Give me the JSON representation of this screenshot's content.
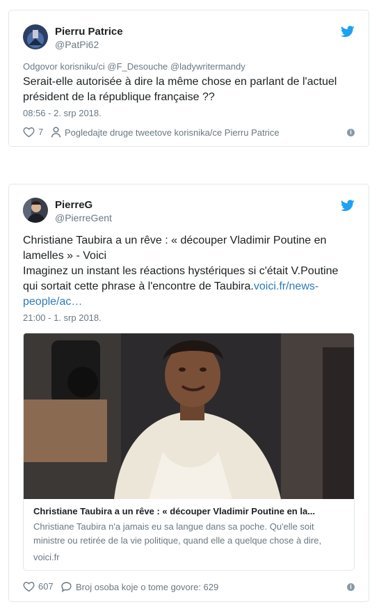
{
  "tweets": [
    {
      "name": "Pierru Patrice",
      "handle": "@PatPi62",
      "reply_to": "Odgovor korisniku/ci @F_Desouche @ladywritermandy",
      "text": "Serait-elle autorisée à dire la même chose en parlant de l'actuel président de la république française ??",
      "time": "08:56 - 2. srp 2018.",
      "likes": "7",
      "action": "Pogledajte druge tweetove korisnika/ce Pierru Patrice"
    },
    {
      "name": "PierreG",
      "handle": "@PierreGent",
      "text_line1": "Christiane Taubira a un rêve : « découper Vladimir Poutine en lamelles » - Voici",
      "text_line2": "Imaginez un instant les réactions hystériques si c'était V.Poutine qui sortait cette phrase à l'encontre de Taubira.",
      "link": "voici.fr/news-people/ac…",
      "time": "21:00 - 1. srp 2018.",
      "card": {
        "title": "Christiane Taubira a un rêve : « découper Vladimir Poutine en la...",
        "description": "Christiane Taubira n'a jamais eu sa langue dans sa poche. Qu'elle soit ministre ou retirée de la vie politique, quand elle a quelque chose à dire,",
        "domain": "voici.fr"
      },
      "likes": "607",
      "action": "Broj osoba koje o tome govore: 629"
    }
  ],
  "icons": {
    "twitter_bird": "twitter-bird-icon",
    "heart": "heart-icon",
    "person": "person-icon",
    "comment": "comment-icon",
    "info": "info-icon"
  },
  "colors": {
    "twitter_blue": "#1da1f2",
    "link": "#2b7bb9",
    "muted": "#697882",
    "border": "#e1e8ed"
  }
}
